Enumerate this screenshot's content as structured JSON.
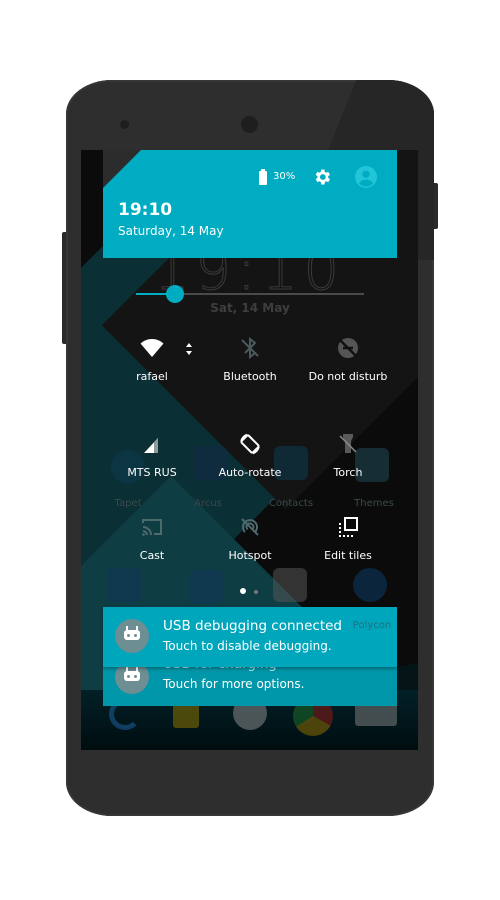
{
  "status": {
    "time": "19:10",
    "date": "Saturday, 14 May",
    "battery_percent": "30%",
    "battery_icon": "battery-charging-icon",
    "settings_icon": "gear-icon",
    "user_icon": "account-circle-icon"
  },
  "lockscreen": {
    "clock": "19:10",
    "date": "Sat, 14 May"
  },
  "brightness": {
    "level": 0.17,
    "accent": "#00acc1"
  },
  "tiles": [
    {
      "label": "rafael",
      "icon": "wifi-icon",
      "active": true
    },
    {
      "label": "Bluetooth",
      "icon": "bluetooth-off-icon",
      "active": false
    },
    {
      "label": "Do not disturb",
      "icon": "do-not-disturb-off-icon",
      "active": false
    },
    {
      "label": "MTS RUS",
      "icon": "cellular-signal-icon",
      "active": true
    },
    {
      "label": "Auto-rotate",
      "icon": "screen-rotation-icon",
      "active": true
    },
    {
      "label": "Torch",
      "icon": "flashlight-off-icon",
      "active": false
    },
    {
      "label": "Cast",
      "icon": "cast-icon",
      "active": false
    },
    {
      "label": "Hotspot",
      "icon": "hotspot-off-icon",
      "active": false
    },
    {
      "label": "Edit tiles",
      "icon": "edit-tiles-icon",
      "active": true
    }
  ],
  "pages": {
    "current": 1,
    "total": 2
  },
  "home_apps": [
    {
      "label": "Tapet"
    },
    {
      "label": "Arcus"
    },
    {
      "label": "Contacts"
    },
    {
      "label": "Themes"
    },
    {
      "label": "Polycon"
    }
  ],
  "notifications": [
    {
      "title": "USB debugging connected",
      "text": "Touch to disable debugging.",
      "icon": "android-debug-icon"
    },
    {
      "title": "USB for charging",
      "text": "Touch for more options.",
      "icon": "android-debug-icon"
    }
  ],
  "colors": {
    "accent": "#00acc1",
    "notification": "#00a7bc"
  }
}
